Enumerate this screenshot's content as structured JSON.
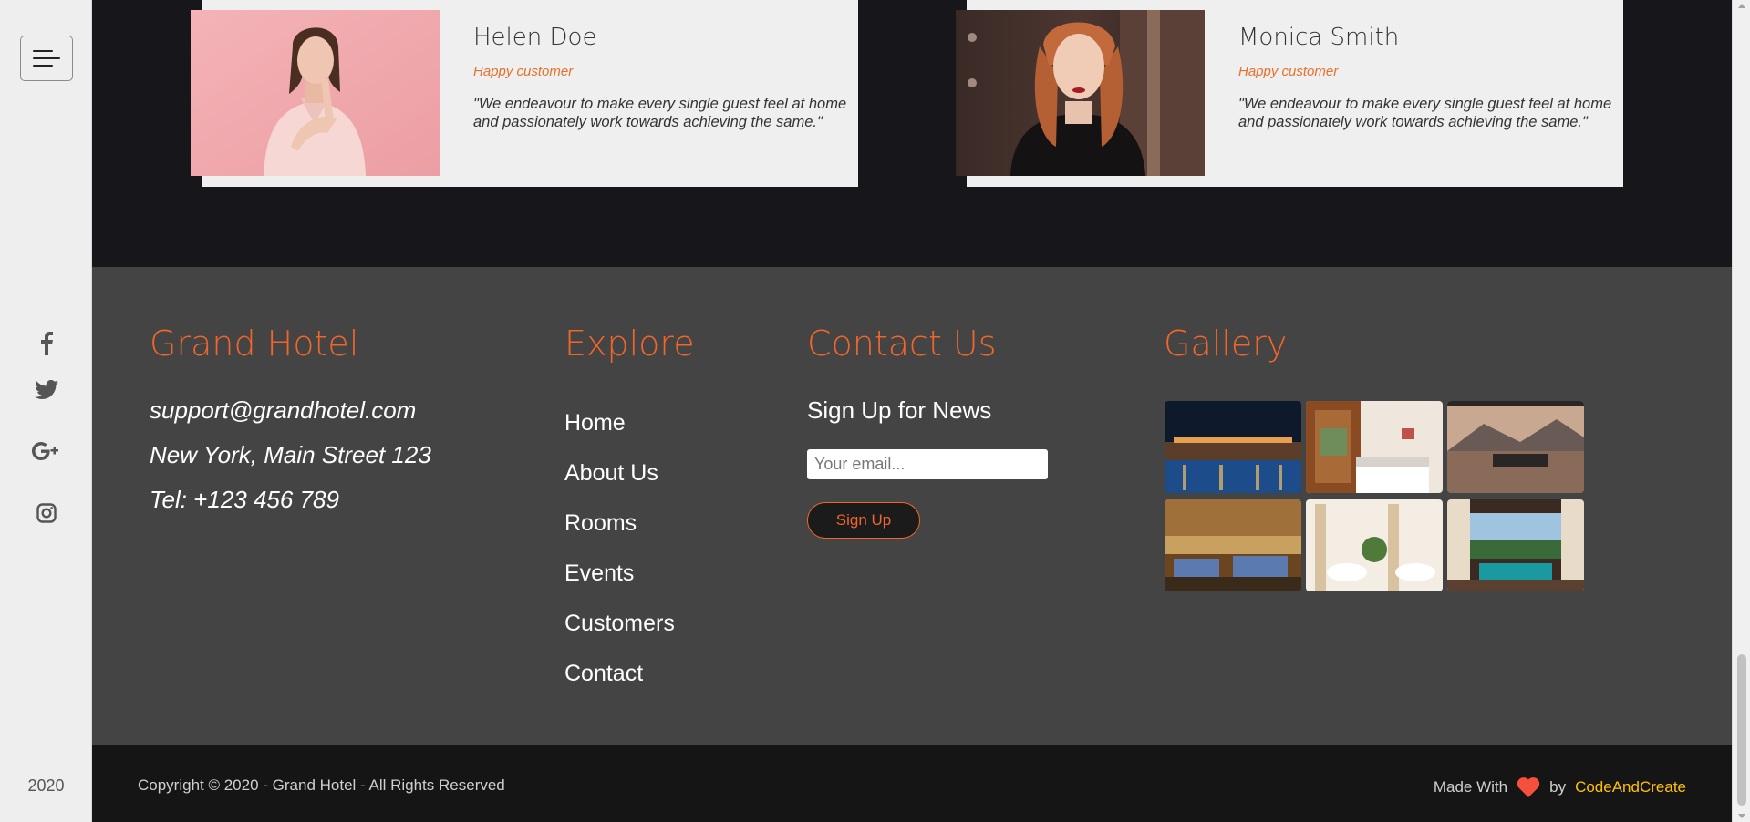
{
  "sidebar": {
    "menu_icon": "hamburger-menu-icon",
    "social_icons": [
      "facebook-icon",
      "twitter-icon",
      "google-plus-icon",
      "instagram-icon"
    ],
    "year": "2020"
  },
  "testimonials": [
    {
      "name": "Helen Doe",
      "role": "Happy customer",
      "quote": "\"We endeavour to make every single guest feel at home and passionately work towards achieving the same.\""
    },
    {
      "name": "Monica Smith",
      "role": "Happy customer",
      "quote": "\"We endeavour to make every single guest feel at home and passionately work towards achieving the same.\""
    }
  ],
  "footer": {
    "about": {
      "title": "Grand Hotel",
      "email": "support@grandhotel.com",
      "address": "New York, Main Street 123",
      "phone": "Tel: +123 456 789"
    },
    "explore": {
      "title": "Explore",
      "links": [
        "Home",
        "About Us",
        "Rooms",
        "Events",
        "Customers",
        "Contact"
      ]
    },
    "contact": {
      "title": "Contact Us",
      "signup_heading": "Sign Up for News",
      "email_placeholder": "Your email...",
      "signup_button": "Sign Up"
    },
    "gallery": {
      "title": "Gallery"
    }
  },
  "bottom": {
    "copyright": "Copyright © 2020 - Grand Hotel - All Rights Reserved",
    "made_with": "Made With",
    "heart_icon": "heart-icon",
    "by": "by",
    "brand": "CodeAndCreate"
  },
  "colors": {
    "accent": "#f0652a",
    "brand_link": "#ffc107",
    "footer_bg": "#444444",
    "dark_bg": "#17161b"
  }
}
